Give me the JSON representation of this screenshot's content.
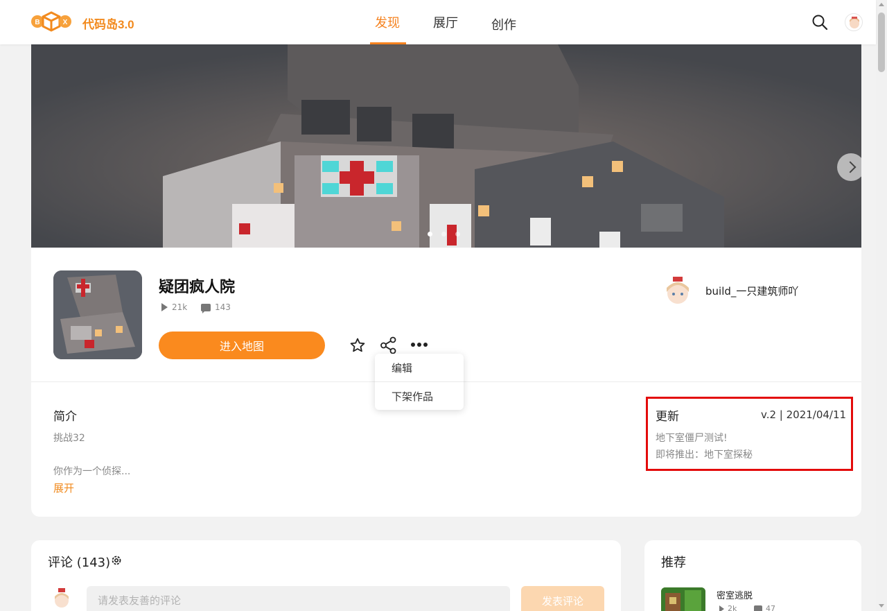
{
  "header": {
    "brand": "代码岛3.0",
    "tabs": [
      {
        "label": "发现",
        "active": true
      },
      {
        "label": "展厅",
        "active": false
      },
      {
        "label": "创作",
        "active": false
      }
    ],
    "accent_color": "#f5821f"
  },
  "banner": {
    "slide_count": 3,
    "active_slide": 1
  },
  "work": {
    "title": "疑团疯人院",
    "plays": "21k",
    "comments": "143",
    "enter_label": "进入地图",
    "more_menu": [
      {
        "label": "编辑"
      },
      {
        "label": "下架作品"
      }
    ]
  },
  "author": {
    "name": "build_一只建筑师吖"
  },
  "intro": {
    "heading": "简介",
    "line1": "挑战32",
    "line2": "你作为一个侦探...",
    "expand": "展开"
  },
  "update": {
    "heading": "更新",
    "meta": "v.2 | 2021/04/11",
    "line1": "地下室僵尸测试!",
    "line2": "即将推出：地下室探秘",
    "highlight_color": "#e30b0b"
  },
  "comments": {
    "heading": "评论 (143)",
    "placeholder": "请发表友善的评论",
    "post_label": "发表评论"
  },
  "recommend": {
    "heading": "推荐",
    "items": [
      {
        "title": "密室逃脱",
        "plays": "2k",
        "comments": "47"
      }
    ]
  }
}
